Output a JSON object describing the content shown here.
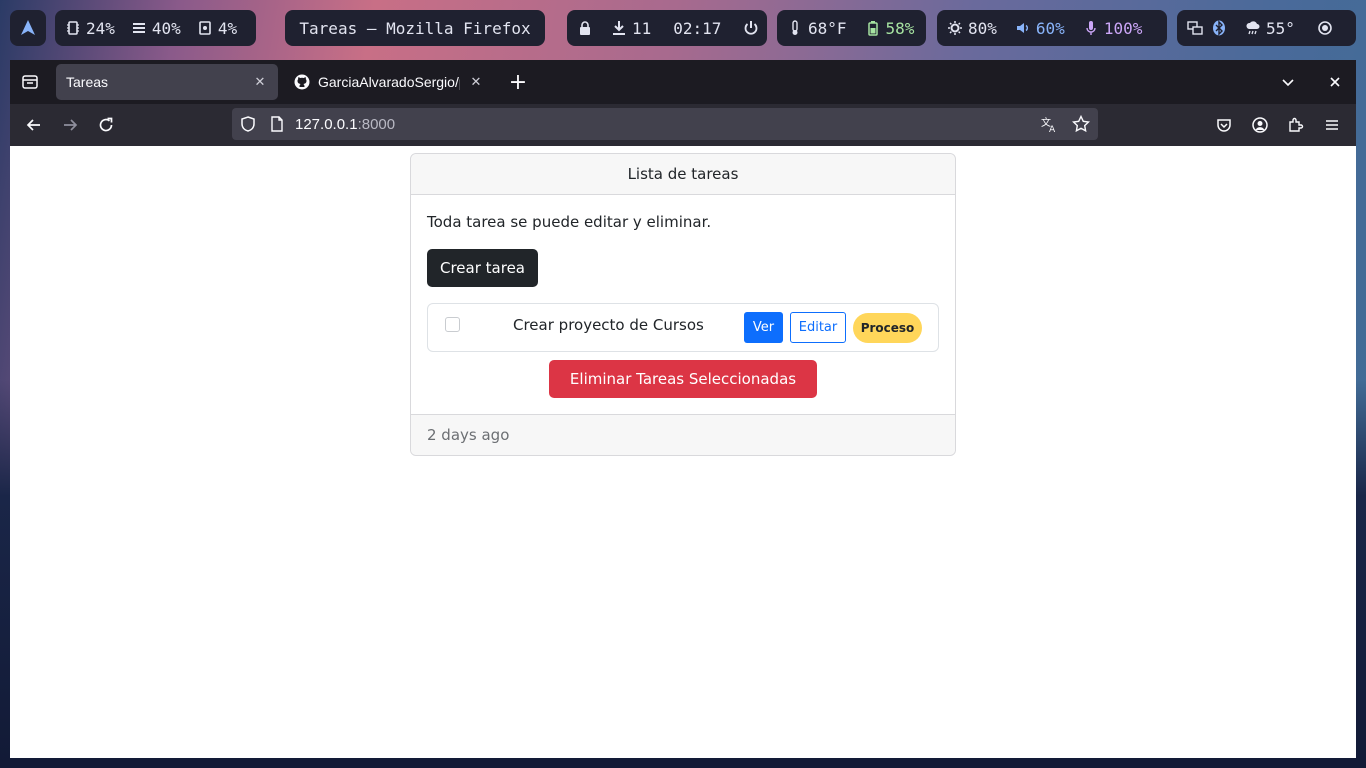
{
  "topbar": {
    "cpu": "24%",
    "mem": "40%",
    "disk": "4%",
    "window_title": "Tareas — Mozilla Firefox",
    "updates": "11",
    "clock": "02:17",
    "temp": "68°F",
    "battery": "58%",
    "brightness": "80%",
    "volume": "60%",
    "mic": "100%",
    "weather": "55°"
  },
  "browser": {
    "tabs": [
      {
        "title": "Tareas",
        "active": true
      },
      {
        "title": "GarciaAlvaradoSergio/pru",
        "active": false
      }
    ],
    "url_host": "127.0.0.1",
    "url_port": ":8000"
  },
  "page": {
    "card_title": "Lista de tareas",
    "description": "Toda tarea se puede editar y eliminar.",
    "create_button": "Crear tarea",
    "tasks": [
      {
        "name": "Crear proyecto de Cursos",
        "view_label": "Ver",
        "edit_label": "Editar",
        "status": "Proceso",
        "checked": false
      }
    ],
    "delete_button": "Eliminar Tareas Seleccionadas",
    "footer": "2 days ago"
  },
  "colors": {
    "primary": "#0d6efd",
    "danger": "#dc3545",
    "warning": "#ffd65a",
    "dark": "#212529"
  }
}
